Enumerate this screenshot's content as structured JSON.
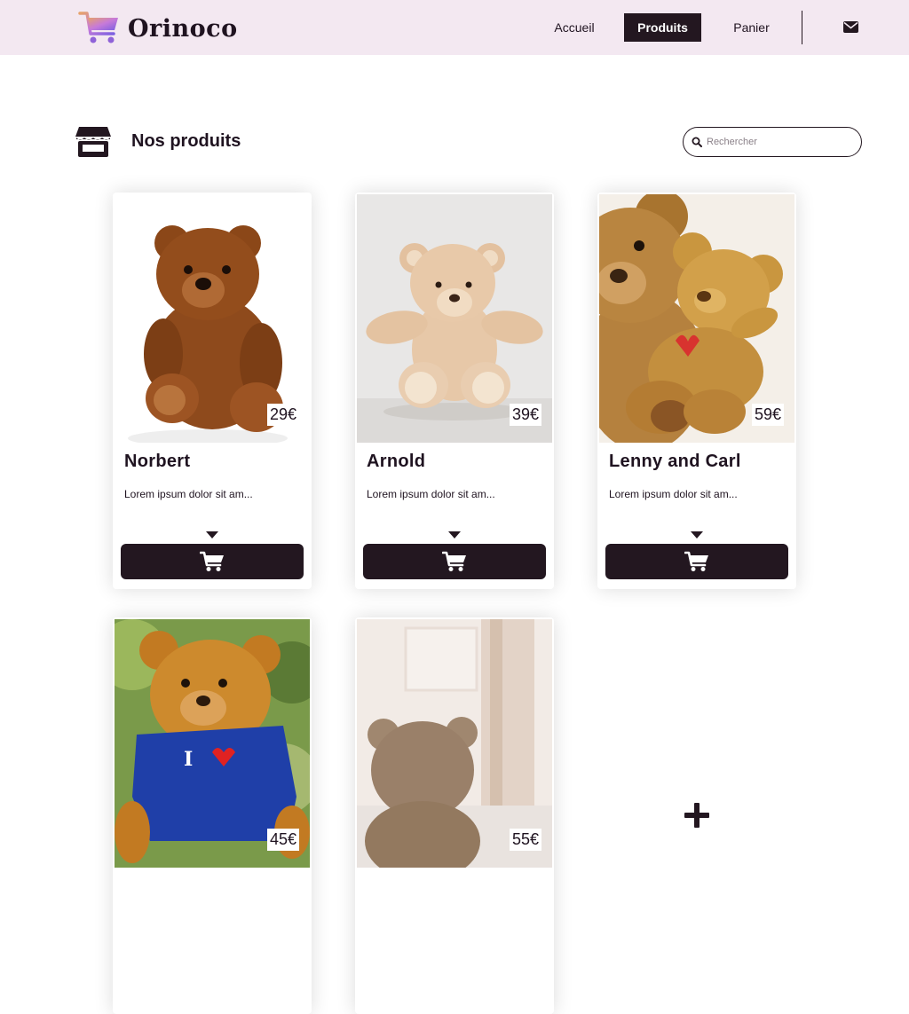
{
  "brand": {
    "name": "Orinoco"
  },
  "nav": {
    "accueil": "Accueil",
    "produits": "Produits",
    "panier": "Panier",
    "mail_icon": "envelope-icon"
  },
  "page": {
    "title": "Nos produits",
    "title_icon": "store-icon"
  },
  "search": {
    "placeholder": "Rechercher",
    "value": ""
  },
  "products": [
    {
      "name": "Norbert",
      "price": "29€",
      "description": "Lorem ipsum dolor sit am..."
    },
    {
      "name": "Arnold",
      "price": "39€",
      "description": "Lorem ipsum dolor sit am..."
    },
    {
      "name": "Lenny and Carl",
      "price": "59€",
      "description": "Lorem ipsum dolor sit am..."
    },
    {
      "name": "",
      "price": "45€",
      "description": ""
    },
    {
      "name": "",
      "price": "55€",
      "description": ""
    }
  ],
  "colors": {
    "header_bg": "#f3e8f1",
    "accent_dark": "#231720",
    "text": "#1f1320"
  }
}
